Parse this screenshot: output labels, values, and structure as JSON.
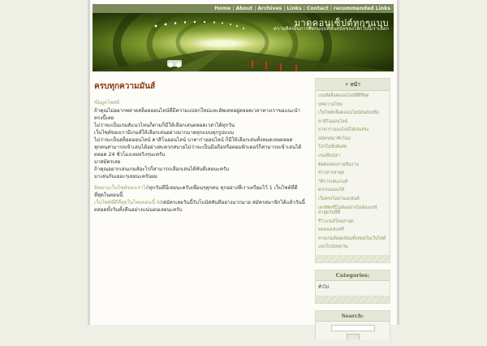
{
  "nav": {
    "items": [
      "Home",
      "About",
      "Archives",
      "Links",
      "Contact",
      "recommended Links"
    ],
    "separator": "|"
  },
  "header": {
    "title": "มาดูคอนเซ็ปต์ทุกๆแบบ",
    "description": "ความคิดเห็นการออกแบบที่ทันสมัยของโลกใบนี้เราเลือก"
  },
  "post": {
    "title": "ครบทุกความมันส์",
    "meta": "ข้อมูลโพสต์",
    "paragraphs": [
      "ถ้าคุณไม่อยากพลาดสล็อตออนไลน์ที่มีความแปลกใหม่และอัพเดทอยู่ตลอดเวลาทางเราขอแนะนำตรงนี้เลย",
      "ไม่ว่าจะเป็นเกมส์แนวไหนก็ตามก็มีให้เลือกเล่นตลอดเวลาได้ทุกวัน",
      "เว็บไซต์ของเรามีเกมส์ให้เลือกเล่นอย่างมากมายทุกแบบทุกรูปแบบ",
      "ไม่ว่าจะเป็นสล็อตออนไลน์ คาสิโนออนไลน์ บาคาร่าออนไลน์ ก็มีให้เลือกเล่นทั้งหมดเลยตลอด",
      "ทุกคนสามารถเข้าเล่นได้อย่างสะดวกสบายไม่ว่าจะเป็นมือถือหรือคอมพิวเตอร์ก็สามารถเข้าเล่นได้ตลอด 24 ชั่วโมงเลยจริงๆนะครับ",
      "มาสมัครเลย",
      "ถ้าคุณอยากเล่นเกมส์อะไรก็สามารถเลือกเล่นได้ทันทีเลยนะครับ",
      "มาเล่นกันเยอะๆเลยนะครับผม"
    ],
    "footer": [
      {
        "link": "ติดตามเว็บไซต์ของเราได้",
        "text": "ทุกวันที่นี่เลยนะครับเพื่อนๆทุกคน ทุกอย่างที่เราเตรียมไว้ 1 เว็บไซต์ที่ดีที่สุดในตอนนี้"
      },
      {
        "link": "เว็บไซต์ที่ดีที่สุดในไทยตอนนี้ 68",
        "text": "สมัครเลยวันนี้รับโบนัสทันทีอย่างมากมาย สมัครสมาชิกได้แล้ววันนี้ตลอดทั้งวันทั้งคืนอย่างแน่นอนเลยนะครับ"
      }
    ]
  },
  "sidebar": {
    "pages_heading": "• หน้า",
    "pages": [
      "เกมส์สล็อตออนไลน์ที่ดีที่สุด",
      "บทความใหม่",
      "เว็บไซต์สล็อตออนไลน์อันดับหนึ่ง",
      "คาสิโนออนไลน์",
      "บาคาร่าออนไลน์ได้เงินจริง",
      "สมัครสมาชิกใหม่",
      "โปรโมชั่นพิเศษ",
      "เกมส์ยิงปลา",
      "ติดต่อสอบถามทีมงาน",
      "ข่าวสารล่าสุด",
      "วิธีการเล่นเกมส์",
      "ฝากถอนออโต้",
      "เว็บตรงไม่ผ่านเอเย่นต์",
      "เครดิตฟรีไม่ต้องฝากไม่ต้องแชร์ล่าสุดวันนี้ที่",
      "รีวิวเกมส์ใหม่ล่าสุด",
      "ทดลองเล่นฟรี",
      "ค่ายเกมส์ยอดนิยมทั้งหมดในเว็บไซต์",
      "แจกโบนัสทุกวัน"
    ],
    "categories_heading": "Categories:",
    "categories": [
      "ทั่วไป"
    ],
    "search_heading": "Search:",
    "search_value": ""
  }
}
